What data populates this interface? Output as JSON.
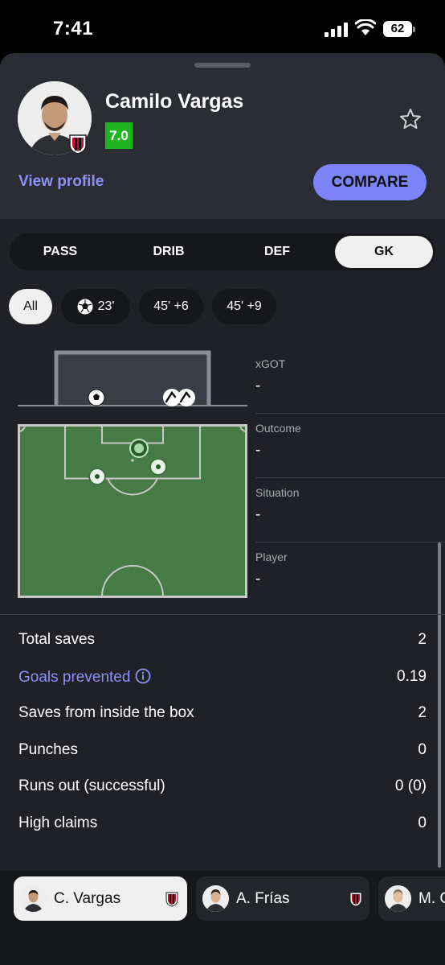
{
  "status_bar": {
    "time": "7:41",
    "battery": "62",
    "icons": [
      "signal-icon",
      "wifi-icon",
      "battery-icon"
    ]
  },
  "header": {
    "player_name": "Camilo Vargas",
    "rating": "7.0",
    "rating_color": "#1fb51f",
    "view_profile": "View profile",
    "compare": "COMPARE",
    "accent": "#7c84f7"
  },
  "tabs": [
    {
      "label": "PASS",
      "active": false
    },
    {
      "label": "DRIB",
      "active": false
    },
    {
      "label": "DEF",
      "active": false
    },
    {
      "label": "GK",
      "active": true
    }
  ],
  "filters": [
    {
      "label": "All",
      "active": true
    },
    {
      "label": "23'",
      "icon": "football-icon",
      "active": false
    },
    {
      "label": "45' +6",
      "active": false
    },
    {
      "label": "45' +9",
      "active": false
    }
  ],
  "shot_info": [
    {
      "label": "xGOT",
      "value": "-"
    },
    {
      "label": "Outcome",
      "value": "-"
    },
    {
      "label": "Situation",
      "value": "-"
    },
    {
      "label": "Player",
      "value": "-"
    }
  ],
  "stats": [
    {
      "label": "Total saves",
      "value": "2"
    },
    {
      "label": "Goals prevented",
      "value": "0.19",
      "info": true
    },
    {
      "label": "Saves from inside the box",
      "value": "2"
    },
    {
      "label": "Punches",
      "value": "0"
    },
    {
      "label": "Runs out (successful)",
      "value": "0 (0)"
    },
    {
      "label": "High claims",
      "value": "0"
    }
  ],
  "players": [
    {
      "name": "C. Vargas",
      "active": true
    },
    {
      "name": "A. Frías",
      "active": false
    },
    {
      "name": "M. C",
      "active": false
    }
  ]
}
